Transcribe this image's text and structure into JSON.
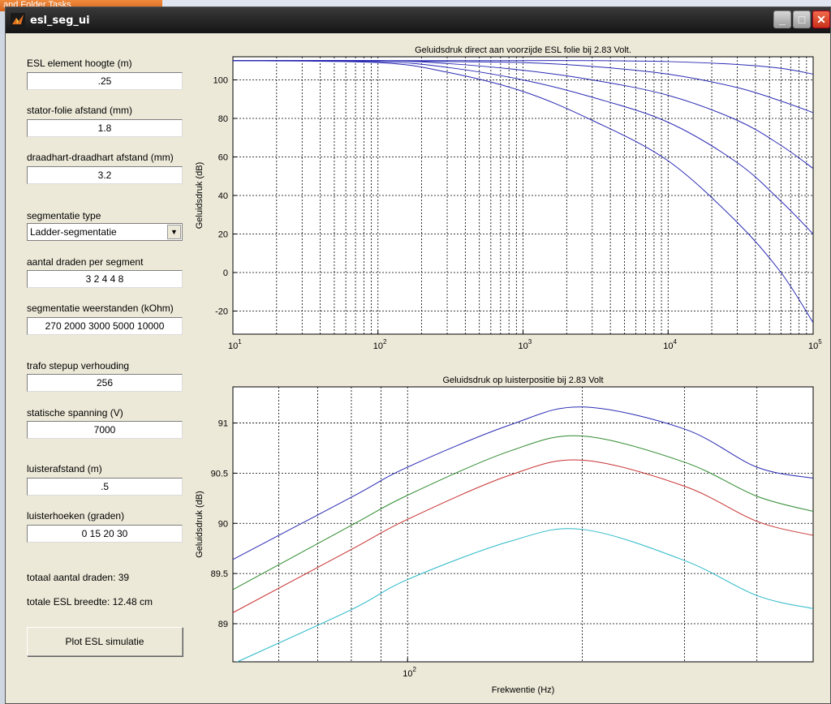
{
  "background": {
    "taskbar_text": "and Folder Tasks"
  },
  "window": {
    "title": "esl_seg_ui"
  },
  "form": {
    "esl_hoogte_label": "ESL element hoogte (m)",
    "esl_hoogte_value": ".25",
    "stator_label": "stator-folie afstand (mm)",
    "stator_value": "1.8",
    "draad_label": "draadhart-draadhart afstand (mm)",
    "draad_value": "3.2",
    "segtype_label": "segmentatie type",
    "segtype_value": "Ladder-segmentatie",
    "aantal_label": "aantal draden per segment",
    "aantal_value": "3 2 4 4 8",
    "weerstand_label": "segmentatie weerstanden (kOhm)",
    "weerstand_value": "270 2000 3000 5000 10000",
    "trafo_label": "trafo stepup verhouding",
    "trafo_value": "256",
    "spanning_label": "statische spanning (V)",
    "spanning_value": "7000",
    "luisterafstand_label": "luisterafstand (m)",
    "luisterafstand_value": ".5",
    "luisterhoeken_label": "luisterhoeken (graden)",
    "luisterhoeken_value": "0 15 20 30",
    "totaal_draden": "totaal aantal draden: 39",
    "totale_breedte": "totale ESL breedte: 12.48 cm",
    "plot_button": "Plot ESL simulatie"
  },
  "chart_data": [
    {
      "type": "line",
      "title": "Geluidsdruk direct aan voorzijde ESL folie bij 2.83 Volt.",
      "ylabel": "Geluidsdruk (dB)",
      "xlabel": "",
      "xscale": "log",
      "xlim": [
        10,
        100000
      ],
      "ylim": [
        -32,
        112
      ],
      "grid": true,
      "yticks": [
        "-20",
        "0",
        "20",
        "40",
        "60",
        "80",
        "100"
      ],
      "xticks": [
        "1",
        "2",
        "3",
        "4",
        "5"
      ],
      "color": "#2a2ab4",
      "series": [
        {
          "x": [
            10,
            100,
            300,
            1000,
            3000,
            10000,
            30000,
            60000,
            100000
          ],
          "values": [
            110,
            110,
            110,
            110,
            110,
            109.5,
            108,
            106,
            103
          ]
        },
        {
          "x": [
            10,
            100,
            300,
            1000,
            3000,
            10000,
            30000,
            60000,
            100000
          ],
          "values": [
            110,
            110,
            109.5,
            109,
            107,
            103,
            96,
            89,
            83
          ]
        },
        {
          "x": [
            10,
            100,
            300,
            1000,
            3000,
            10000,
            30000,
            60000,
            100000
          ],
          "values": [
            110,
            110,
            108.5,
            105,
            100,
            92,
            79,
            66,
            54
          ]
        },
        {
          "x": [
            10,
            100,
            300,
            1000,
            3000,
            10000,
            30000,
            60000,
            100000
          ],
          "values": [
            110,
            109.5,
            106.5,
            100,
            91,
            78,
            57,
            37,
            20
          ]
        },
        {
          "x": [
            10,
            100,
            300,
            1000,
            3000,
            10000,
            30000,
            60000,
            100000
          ],
          "values": [
            110,
            109,
            104,
            94,
            79,
            58,
            26,
            0,
            -26
          ]
        }
      ]
    },
    {
      "type": "line",
      "title": "Geluidsdruk op luisterpositie bij 2.83 Volt",
      "ylabel": "Geluidsdruk (dB)",
      "xlabel": "Frekwentie (Hz)",
      "xscale": "log",
      "xlim": [
        50,
        500
      ],
      "ylim": [
        88.62,
        91.36
      ],
      "grid": true,
      "yticks": [
        "89",
        "89.5",
        "90",
        "90.5",
        "91"
      ],
      "xticks": [
        "2"
      ],
      "series": [
        {
          "color": "#2a2ab4",
          "x": [
            50,
            80,
            100,
            150,
            200,
            300,
            400,
            500
          ],
          "values": [
            89.64,
            90.26,
            90.56,
            90.98,
            91.16,
            90.94,
            90.56,
            90.45
          ]
        },
        {
          "color": "#2e8a2e",
          "x": [
            50,
            80,
            100,
            150,
            200,
            300,
            400,
            500
          ],
          "values": [
            89.34,
            89.98,
            90.28,
            90.72,
            90.87,
            90.61,
            90.27,
            90.12
          ]
        },
        {
          "color": "#c83030",
          "x": [
            50,
            80,
            100,
            150,
            200,
            300,
            400,
            500
          ],
          "values": [
            89.11,
            89.74,
            90.04,
            90.48,
            90.63,
            90.37,
            90.02,
            89.88
          ]
        },
        {
          "color": "#28b8c8",
          "x": [
            50,
            80,
            100,
            150,
            200,
            300,
            400,
            500
          ],
          "values": [
            88.6,
            89.14,
            89.44,
            89.82,
            89.94,
            89.63,
            89.28,
            89.15
          ]
        }
      ]
    }
  ]
}
